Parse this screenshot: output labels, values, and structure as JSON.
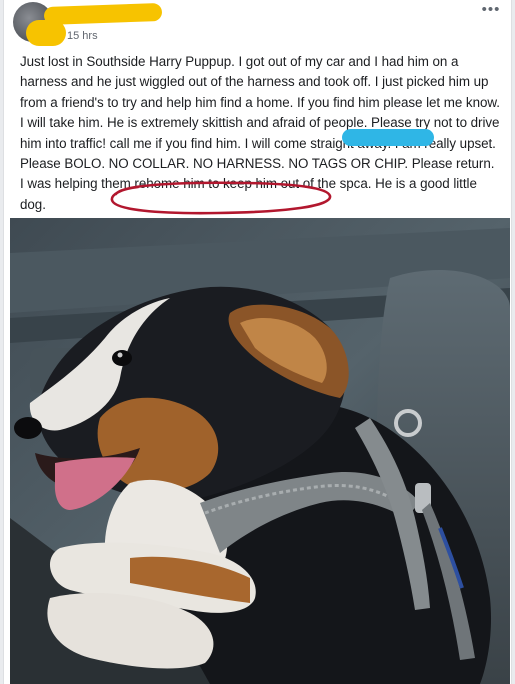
{
  "post": {
    "author_name": "",
    "timestamp": "15 hrs",
    "more_icon": "ellipsis-icon",
    "text": "Just lost in Southside Harry Puppup. I got out of my car and I had him on a harness and he just wiggled out of the harness and took off. I just picked him up from a friend's to try and help him find a home. If you find him please let me know. I will take him. He is extremely skittish and afraid of people. Please try not to drive him into traffic! call me                        if you find him. I will come straight away. I am really upset. Please BOLO. NO COLLAR. NO HARNESS. NO TAGS OR CHIP. Please return. I was helping them rehome him to keep him out of the spca. He is a good little dog.",
    "photo": "dog-in-car-photo"
  },
  "colors": {
    "redaction_name": "#f7c300",
    "redaction_phone": "#2fb6e6",
    "annotation_circle": "#b2172e"
  }
}
